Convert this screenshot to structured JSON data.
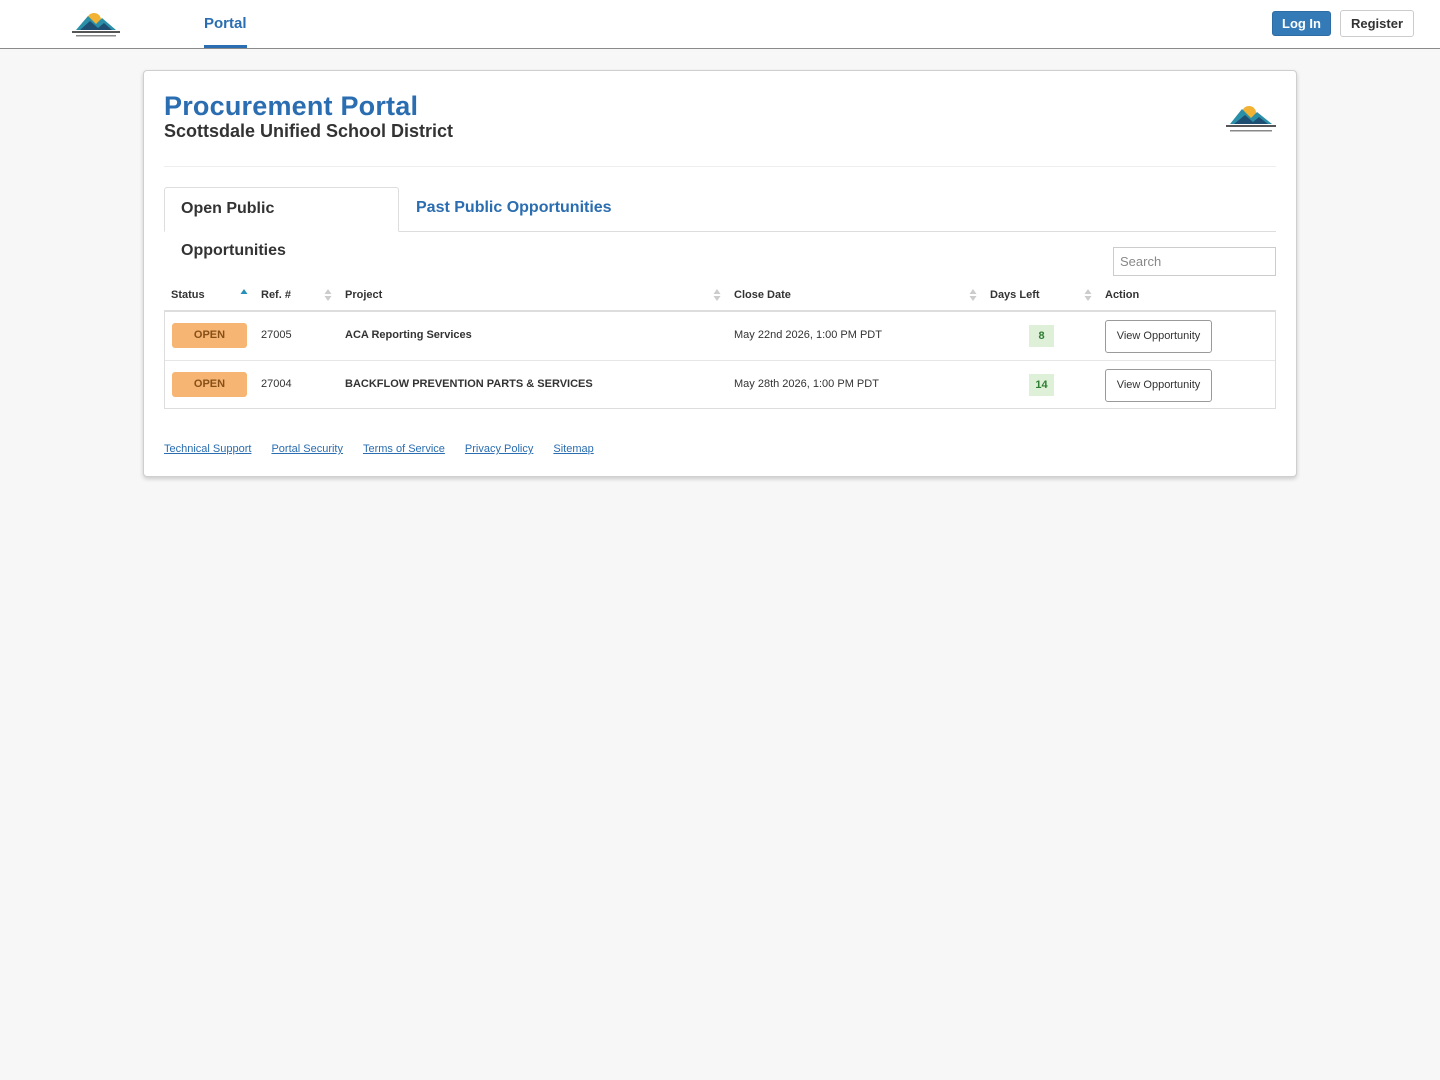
{
  "nav": {
    "logo_icon": "scottsdale-usd-logo",
    "portal_label": "Portal",
    "login_label": "Log In",
    "register_label": "Register"
  },
  "header": {
    "title": "Procurement Portal",
    "subtitle": "Scottsdale Unified School District"
  },
  "tabs": [
    {
      "label": "Open Public Opportunities",
      "active": true
    },
    {
      "label": "Past Public Opportunities",
      "active": false
    }
  ],
  "search": {
    "placeholder": "Search",
    "value": ""
  },
  "table": {
    "columns": [
      "Status",
      "Ref. #",
      "Project",
      "Close Date",
      "Days Left",
      "Action"
    ],
    "sort": {
      "column": "Status",
      "direction": "asc"
    },
    "rows": [
      {
        "status": "OPEN",
        "ref": "27005",
        "project": "ACA Reporting Services",
        "close_date": "May 22nd 2026, 1:00 PM PDT",
        "days_left": "8",
        "action": "View Opportunity"
      },
      {
        "status": "OPEN",
        "ref": "27004",
        "project": "BACKFLOW PREVENTION PARTS & SERVICES",
        "close_date": "May 28th 2026, 1:00 PM PDT",
        "days_left": "14",
        "action": "View Opportunity"
      }
    ]
  },
  "footer": {
    "links": [
      "Technical Support",
      "Portal Security",
      "Terms of Service",
      "Privacy Policy",
      "Sitemap"
    ]
  },
  "colors": {
    "brand_blue": "#2a6db0",
    "status_open": "#f6ad63",
    "days_left_bg": "#dff0d8"
  }
}
